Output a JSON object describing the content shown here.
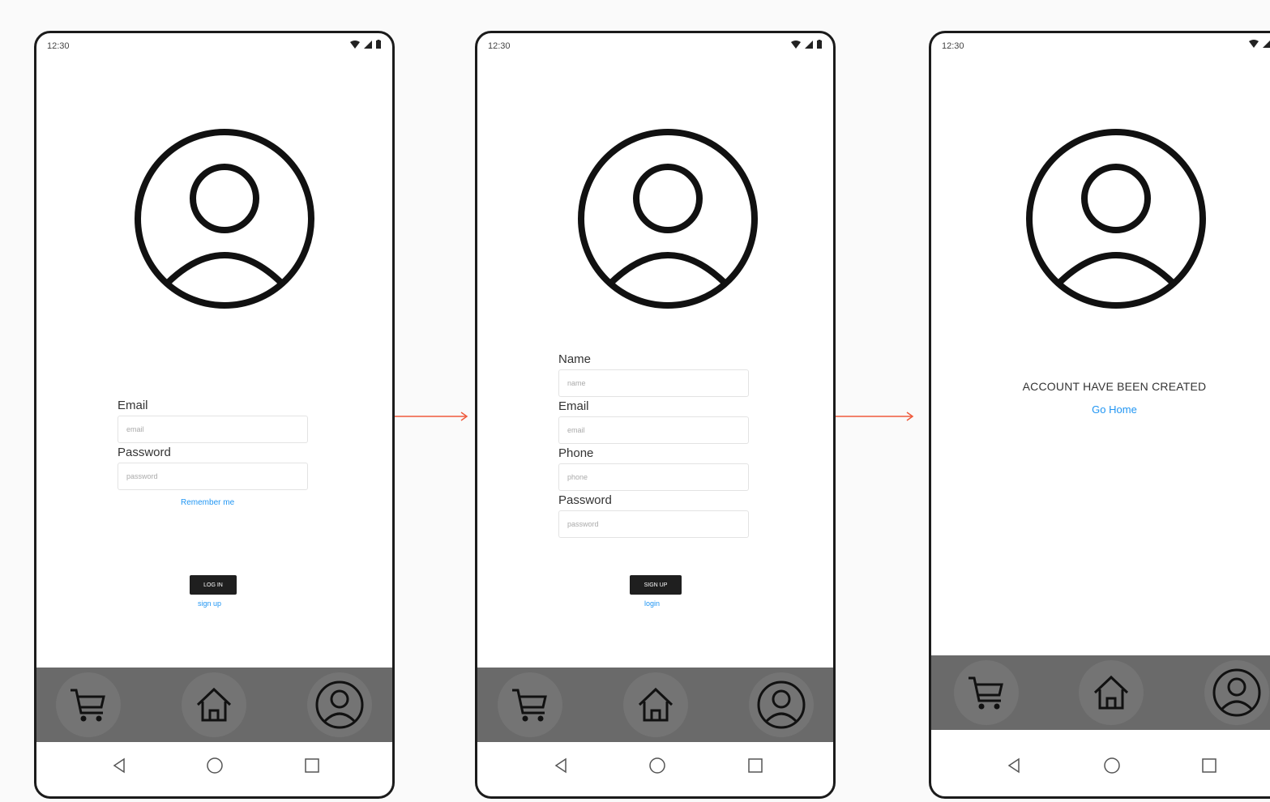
{
  "status_time": "12:30",
  "colors": {
    "link": "#2196f3",
    "nav_bar": "#6a6a6a",
    "arrow": "#ef5a3c",
    "button": "#1f1f1f"
  },
  "login": {
    "email_label": "Email",
    "email_placeholder": "email",
    "password_label": "Password",
    "password_placeholder": "password",
    "remember": "Remember me",
    "login_button": "LOG IN",
    "signup_link": "sign up"
  },
  "signup": {
    "name_label": "Name",
    "name_placeholder": "name",
    "email_label": "Email",
    "email_placeholder": "email",
    "phone_label": "Phone",
    "phone_placeholder": "phone",
    "password_label": "Password",
    "password_placeholder": "password",
    "signup_button": "SIGN UP",
    "login_link": "login"
  },
  "success": {
    "message": "ACCOUNT HAVE BEEN CREATED",
    "go_home": "Go Home"
  },
  "nav_icons": [
    "cart-icon",
    "home-icon",
    "user-icon"
  ],
  "system_icons": [
    "back-icon",
    "home-circle-icon",
    "recents-icon"
  ]
}
